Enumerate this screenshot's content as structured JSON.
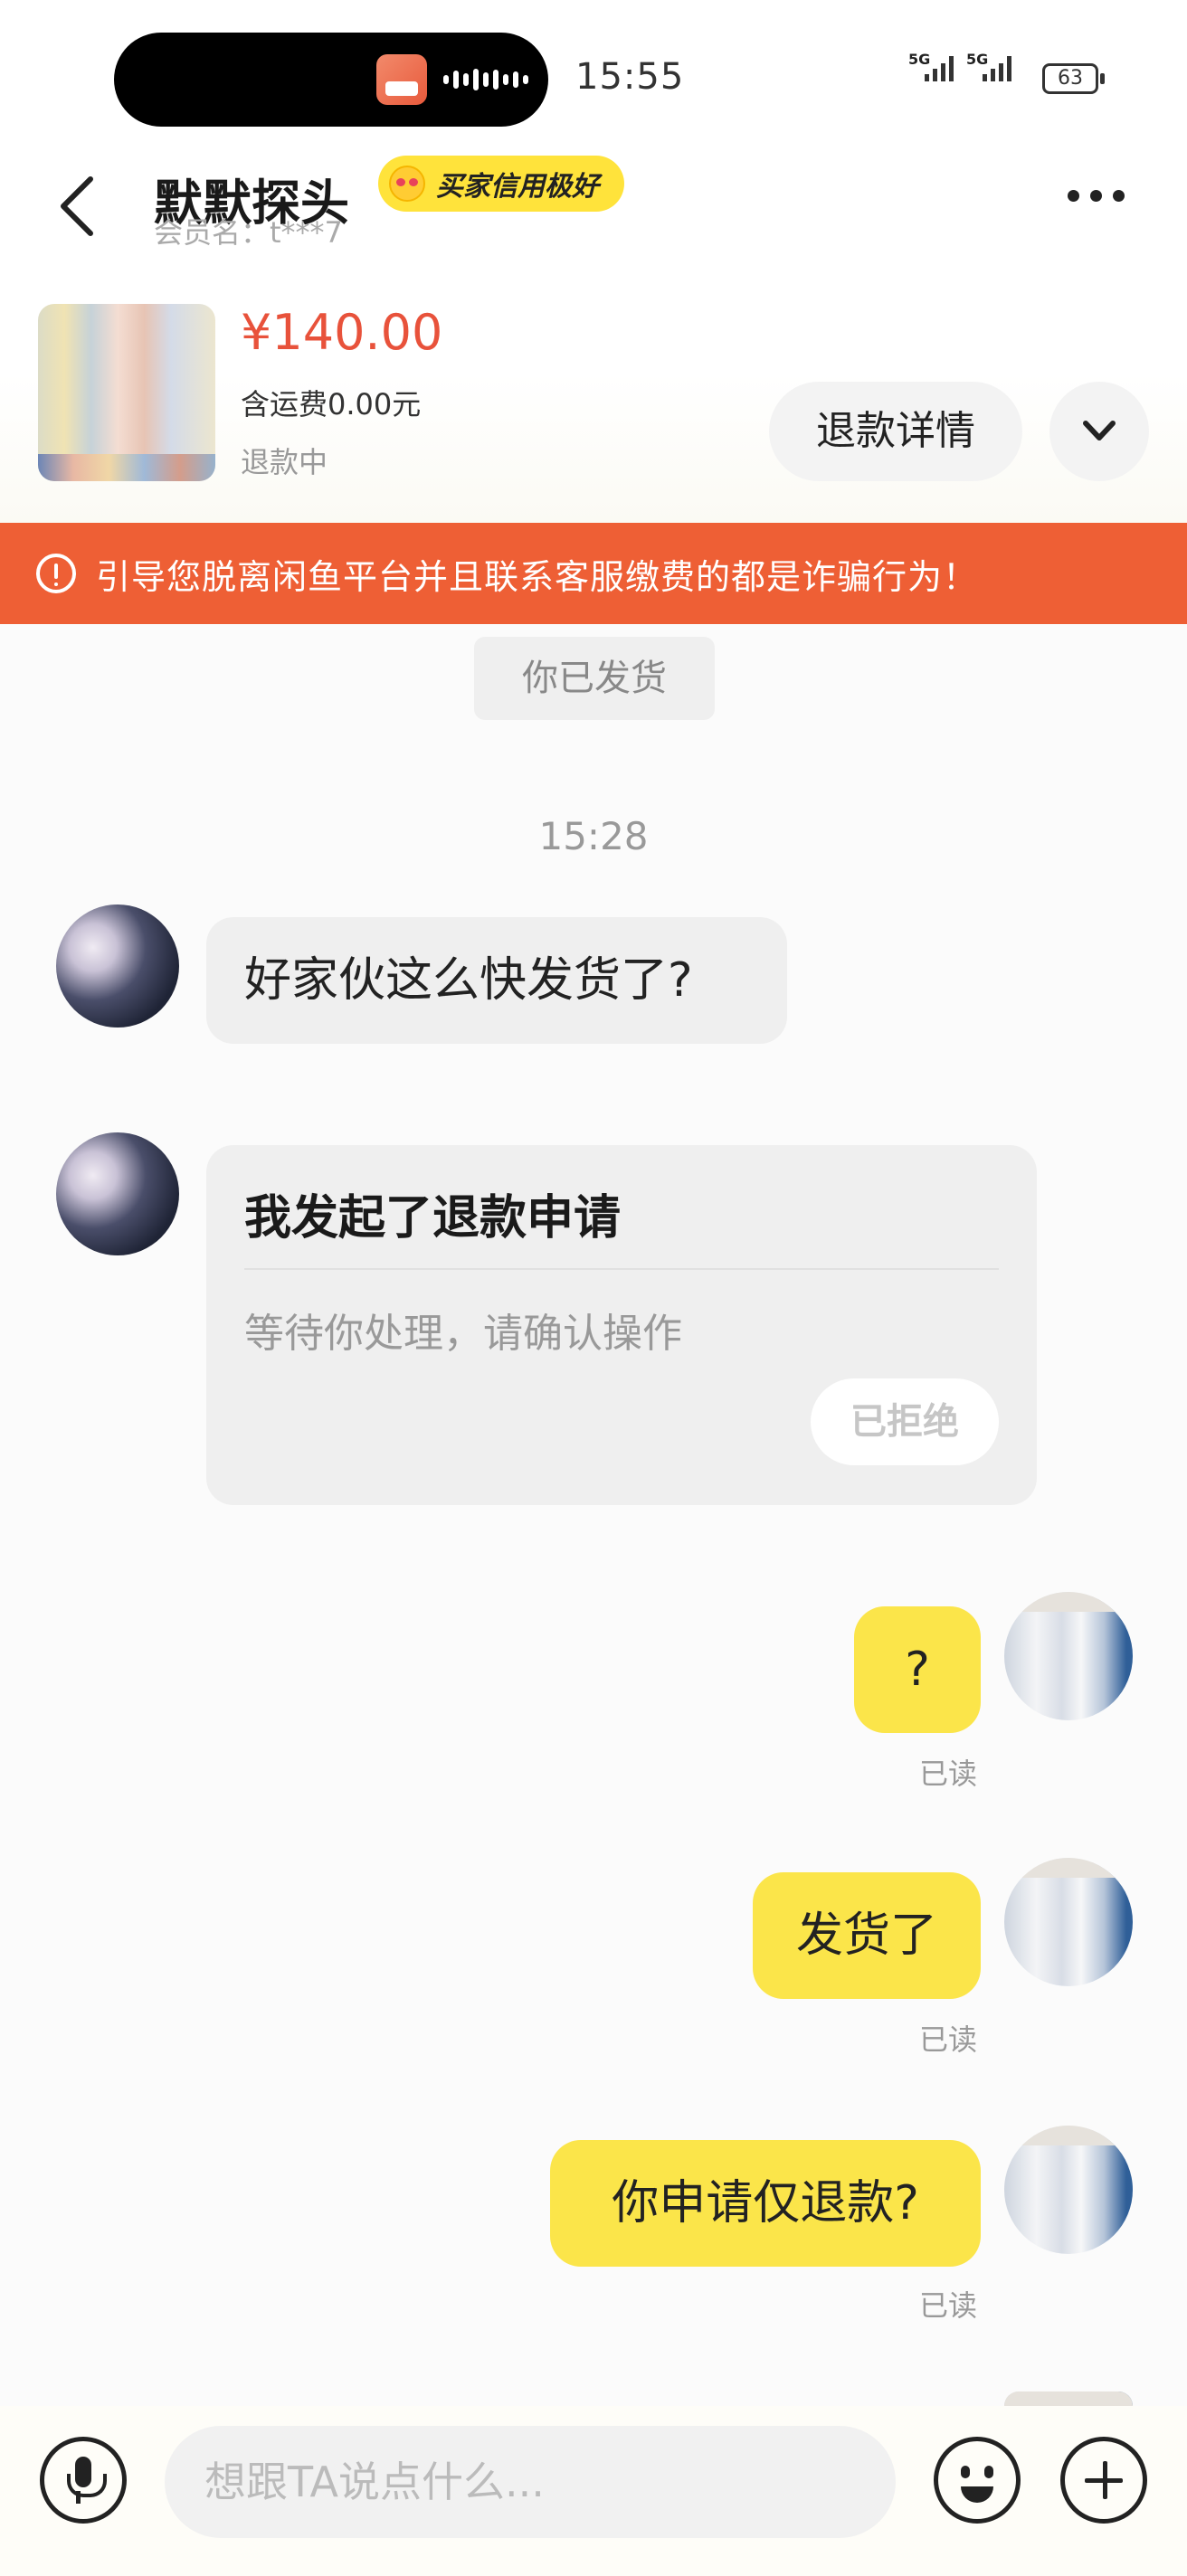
{
  "status_bar": {
    "time": "15:55",
    "signal_1": "5G",
    "signal_2": "5G",
    "battery": "63"
  },
  "header": {
    "title": "默默探头",
    "credit_badge": "买家信用极好",
    "member_name": "会员名：t***7"
  },
  "product": {
    "price": "¥140.00",
    "shipping": "含运费0.00元",
    "status": "退款中",
    "detail_button": "退款详情"
  },
  "warning": {
    "text": "引导您脱离闲鱼平台并且联系客服缴费的都是诈骗行为！"
  },
  "chat": {
    "system_message": "你已发货",
    "timestamp": "15:28",
    "messages": [
      {
        "side": "in",
        "text": "好家伙这么快发货了?"
      },
      {
        "side": "in",
        "card_title": "我发起了退款申请",
        "card_subtitle": "等待你处理，请确认操作",
        "card_button": "已拒绝"
      },
      {
        "side": "out",
        "text": "?",
        "status": "已读"
      },
      {
        "side": "out",
        "text": "发货了",
        "status": "已读"
      },
      {
        "side": "out",
        "text": "你申请仅退款?",
        "status": "已读"
      }
    ]
  },
  "input_bar": {
    "placeholder": "想跟TA说点什么..."
  },
  "colors": {
    "accent_price": "#e8523b",
    "warning_bg": "#ee5f35",
    "out_bubble": "#fbe54a",
    "credit_badge": "#ffe33b"
  },
  "icons": [
    "back-icon",
    "more-icon",
    "chevron-down-icon",
    "warning-icon",
    "mic-icon",
    "emoji-icon",
    "plus-icon"
  ]
}
